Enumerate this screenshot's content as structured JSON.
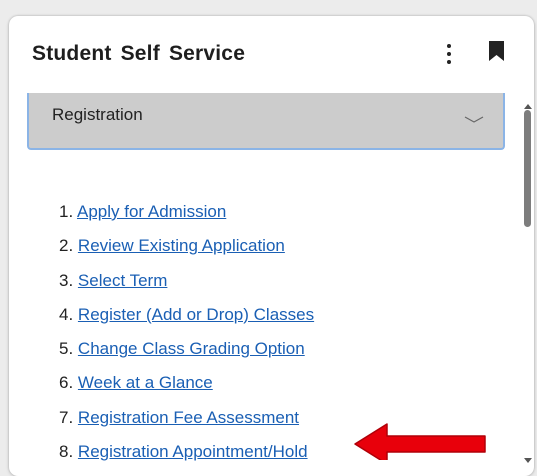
{
  "card": {
    "title": "Student Self Service",
    "menu_icon": "kebab-menu-icon",
    "bookmark_icon": "bookmark-icon"
  },
  "accordion": {
    "label": "Registration",
    "state": "expanded",
    "chevron_icon": "chevron-down-icon"
  },
  "links": [
    {
      "number": "1.",
      "label": "Apply for Admission"
    },
    {
      "number": "2.",
      "label": "Review Existing Application"
    },
    {
      "number": "3.",
      "label": "Select Term"
    },
    {
      "number": "4.",
      "label": "Register (Add or Drop) Classes"
    },
    {
      "number": "5.",
      "label": "Change Class Grading Option"
    },
    {
      "number": "6.",
      "label": "Week at a Glance"
    },
    {
      "number": "7.",
      "label": "Registration Fee Assessment"
    },
    {
      "number": "8.",
      "label": "Registration Appointment/Hold"
    }
  ],
  "annotation": {
    "icon": "red-arrow-icon",
    "points_to": "Registration Appointment/Hold",
    "color": "#e8000b"
  },
  "colors": {
    "link": "#1a5fb4",
    "accordion_bg": "#cccccc",
    "accordion_border": "#8bb4e6"
  }
}
